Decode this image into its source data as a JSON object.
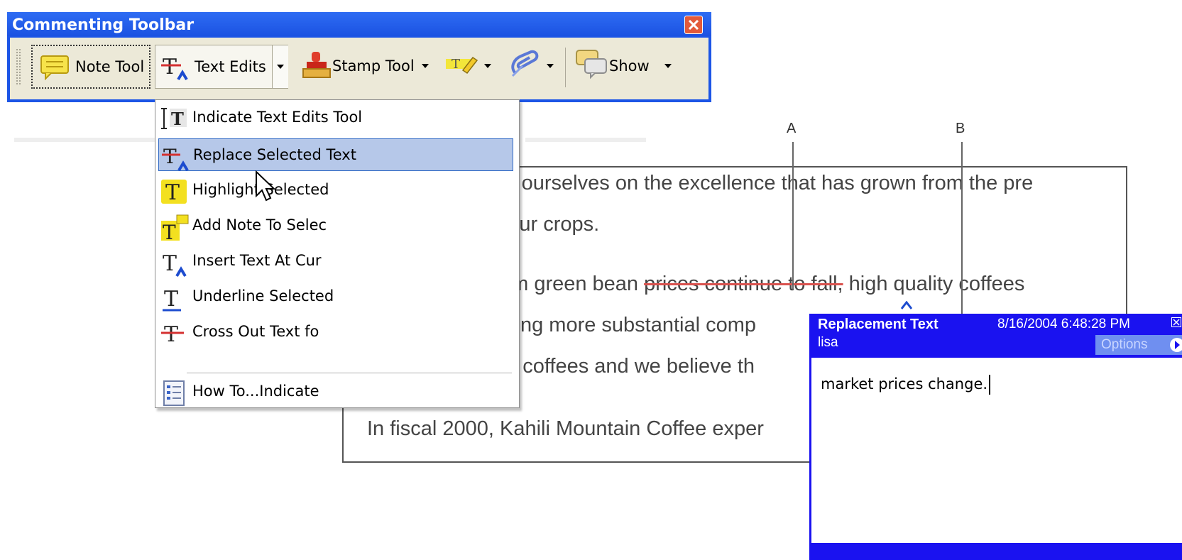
{
  "toolbar": {
    "title": "Commenting Toolbar",
    "note_tool_label": "Note Tool",
    "text_edits_label": "Text Edits",
    "stamp_tool_label": "Stamp Tool",
    "show_label": "Show"
  },
  "menu": {
    "items": [
      {
        "label": "Indicate Text Edits Tool",
        "icon": "text-edits-tool-icon"
      },
      {
        "label": "Replace Selected Text",
        "icon": "replace-text-icon",
        "selected": true
      },
      {
        "label": "Highlight Selected",
        "icon": "highlight-text-icon"
      },
      {
        "label": "Add Note To Selec",
        "icon": "note-text-icon"
      },
      {
        "label": "Insert Text At Cur",
        "icon": "insert-text-icon"
      },
      {
        "label": "Underline Selected",
        "icon": "underline-text-icon"
      },
      {
        "label": "Cross Out Text fo",
        "icon": "cross-out-text-icon"
      },
      {
        "label": "How To...Indicate",
        "icon": "how-to-icon"
      }
    ]
  },
  "document": {
    "line1": "export and pride ourselves on the excellence that has grown from the pre",
    "line2": "used to culture our crops.",
    "line3_pre": "As revenues from green bean ",
    "line3_strike": "prices continue to fall,",
    "line3_post": " high quality coffees",
    "line4": "the few in receiving more substantial comp",
    "line5": "earned for these coffees and we believe th",
    "line6": "In fiscal 2000, Kahili Mountain Coffee exper"
  },
  "callouts": {
    "a": "A",
    "b": "B"
  },
  "note_popup": {
    "title": "Replacement Text",
    "date": "8/16/2004 6:48:28 PM",
    "author": "lisa",
    "options_label": "Options",
    "body": "market prices change."
  },
  "colors": {
    "titlebar": "#1c55e6",
    "note_header": "#1a12f0",
    "menu_selected": "#b6c8e9",
    "strike": "#d9534f"
  }
}
